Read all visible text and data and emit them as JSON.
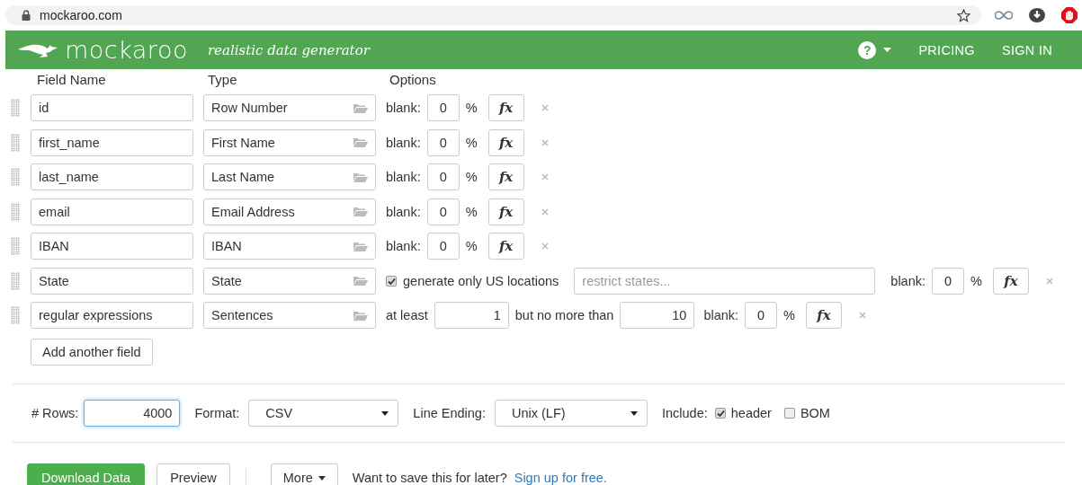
{
  "browser": {
    "url": "mockaroo.com"
  },
  "header": {
    "brand": "mockaroo",
    "tagline": "realistic data generator",
    "help": "?",
    "nav": [
      "PRICING",
      "SIGN IN"
    ]
  },
  "columns": [
    "Field Name",
    "Type",
    "Options"
  ],
  "fields": [
    {
      "kind": "blank",
      "name": "id",
      "type": "Row Number",
      "blank_label": "blank:",
      "blank": "0",
      "percent": "%",
      "fx": "fx"
    },
    {
      "kind": "blank",
      "name": "first_name",
      "type": "First Name",
      "blank_label": "blank:",
      "blank": "0",
      "percent": "%",
      "fx": "fx"
    },
    {
      "kind": "blank",
      "name": "last_name",
      "type": "Last Name",
      "blank_label": "blank:",
      "blank": "0",
      "percent": "%",
      "fx": "fx"
    },
    {
      "kind": "blank",
      "name": "email",
      "type": "Email Address",
      "blank_label": "blank:",
      "blank": "0",
      "percent": "%",
      "fx": "fx"
    },
    {
      "kind": "blank",
      "name": "IBAN",
      "type": "IBAN",
      "blank_label": "blank:",
      "blank": "0",
      "percent": "%",
      "fx": "fx"
    },
    {
      "kind": "state",
      "name": "State",
      "type": "State",
      "checked": true,
      "check_label": "generate only US locations",
      "placeholder": "restrict states...",
      "blank_label": "blank:",
      "blank": "0",
      "percent": "%",
      "fx": "fx"
    },
    {
      "kind": "range",
      "name": "regular expressions",
      "type": "Sentences",
      "min_label": "at least",
      "min": "1",
      "max_label": "but no more than",
      "max": "10",
      "blank_label": "blank:",
      "blank": "0",
      "percent": "%",
      "fx": "fx"
    }
  ],
  "add_button": "Add another field",
  "settings": {
    "rows_label": "# Rows:",
    "rows": "4000",
    "rows_focused": true,
    "format_label": "Format:",
    "format": "CSV",
    "line_ending_label": "Line Ending:",
    "line_ending": "Unix (LF)",
    "include_label": "Include:",
    "include": [
      {
        "label": "header",
        "checked": true
      },
      {
        "label": "BOM",
        "checked": false
      }
    ]
  },
  "actions": {
    "download": "Download Data",
    "preview": "Preview",
    "more": "More",
    "prompt": "Want to save this for later?",
    "link": "Sign up for free."
  }
}
